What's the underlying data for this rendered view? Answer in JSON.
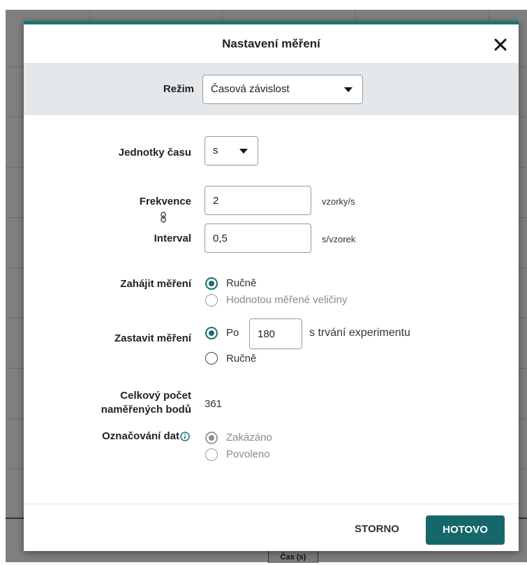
{
  "background": {
    "table_header": "Čas (s)"
  },
  "dialog": {
    "title": "Nastavení měření",
    "close_icon": "close-icon",
    "mode": {
      "label": "Režim",
      "value": "Časová závislost"
    },
    "time_units": {
      "label": "Jednotky času",
      "value": "s"
    },
    "frequency": {
      "label": "Frekvence",
      "value": "2",
      "unit": "vzorky/s"
    },
    "link_icon": "link-icon",
    "interval": {
      "label": "Interval",
      "value": "0,5",
      "unit": "s/vzorek"
    },
    "start": {
      "label": "Zahájit měření",
      "options": [
        {
          "label": "Ručně",
          "selected": true,
          "disabled": false
        },
        {
          "label": "Hodnotou měřené veličiny",
          "selected": false,
          "disabled": true
        }
      ]
    },
    "stop": {
      "label": "Zastavit měření",
      "after_prefix": "Po",
      "duration_value": "180",
      "after_suffix": "s trvání experimentu",
      "manual_label": "Ručně",
      "selected": "after"
    },
    "total_points": {
      "label_line1": "Celkový počet",
      "label_line2": "naměřených bodů",
      "value": "361"
    },
    "data_marking": {
      "label": "Označování dat",
      "info_icon": "info-icon",
      "options": [
        {
          "label": "Zakázáno",
          "selected": true
        },
        {
          "label": "Povoleno",
          "selected": false
        }
      ]
    },
    "buttons": {
      "cancel": "STORNO",
      "done": "HOTOVO"
    }
  },
  "colors": {
    "accent": "#1a7475",
    "primary_button": "#16676a",
    "band": "#e5e8ea",
    "overlay": "#7f7f7f"
  }
}
